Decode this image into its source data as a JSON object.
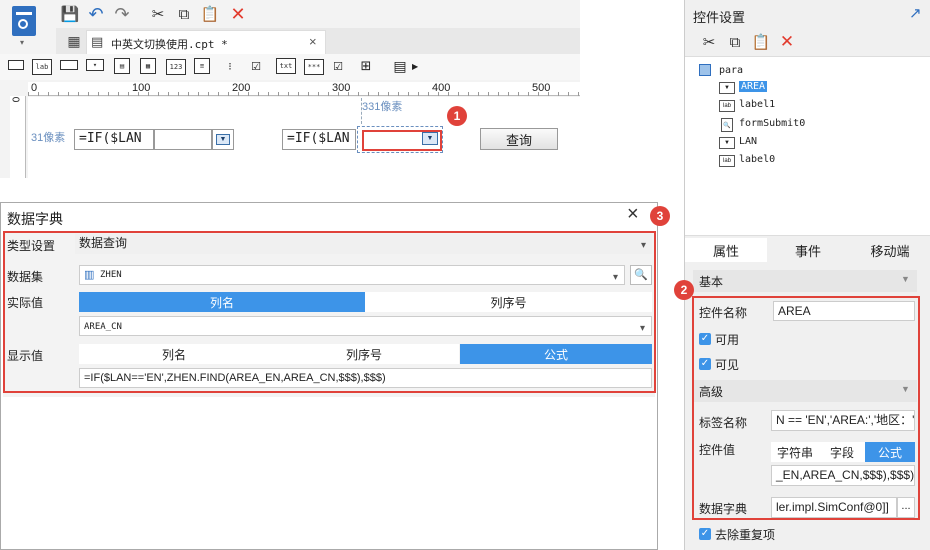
{
  "editor": {
    "tab_label": "中英文切换使用.cpt *",
    "ruler_ticks": [
      "0",
      "100",
      "200",
      "300",
      "400",
      "500"
    ],
    "ruler_v_zero": "0",
    "px_label_top": "331像素",
    "px_label_left": "31像素",
    "formula_1": "=IF($LAN",
    "formula_2": "=IF($LAN",
    "query_button": "查询"
  },
  "dialog": {
    "title": "数据字典",
    "type_label": "类型设置",
    "type_value": "数据查询",
    "dataset_label": "数据集",
    "dataset_value": "ZHEN",
    "actual_label": "实际值",
    "actual_tabs": [
      "列名",
      "列序号"
    ],
    "actual_value": "AREA_CN",
    "display_label": "显示值",
    "display_tabs": [
      "列名",
      "列序号",
      "公式"
    ],
    "display_formula": "=IF($LAN=='EN',ZHEN.FIND(AREA_EN,AREA_CN,$$$),$$$)"
  },
  "right_panel": {
    "title": "控件设置",
    "tree": [
      "para",
      "AREA",
      "label1",
      "formSubmit0",
      "LAN",
      "label0"
    ],
    "tabs": [
      "属性",
      "事件",
      "移动端"
    ],
    "section_basic": "基本",
    "name_label": "控件名称",
    "name_value": "AREA",
    "enabled_label": "可用",
    "visible_label": "可见",
    "section_advanced": "高级",
    "label_name_label": "标签名称",
    "label_name_value": "N == 'EN','AREA:','地区：')",
    "widget_value_label": "控件值",
    "widget_value_tabs": [
      "字符串",
      "字段",
      "公式"
    ],
    "widget_value_formula": "_EN,AREA_CN,$$$),$$$)",
    "dict_label": "数据字典",
    "dict_value": "ler.impl.SimConf@0]]",
    "dict_more": "...",
    "dedupe_label": "去除重复项"
  },
  "badges": [
    "1",
    "2",
    "3"
  ],
  "colors": {
    "accent": "#3d94e8",
    "highlight": "#e0423a",
    "icon_blue": "#2f6fbf",
    "icon_red": "#e23b2e"
  }
}
